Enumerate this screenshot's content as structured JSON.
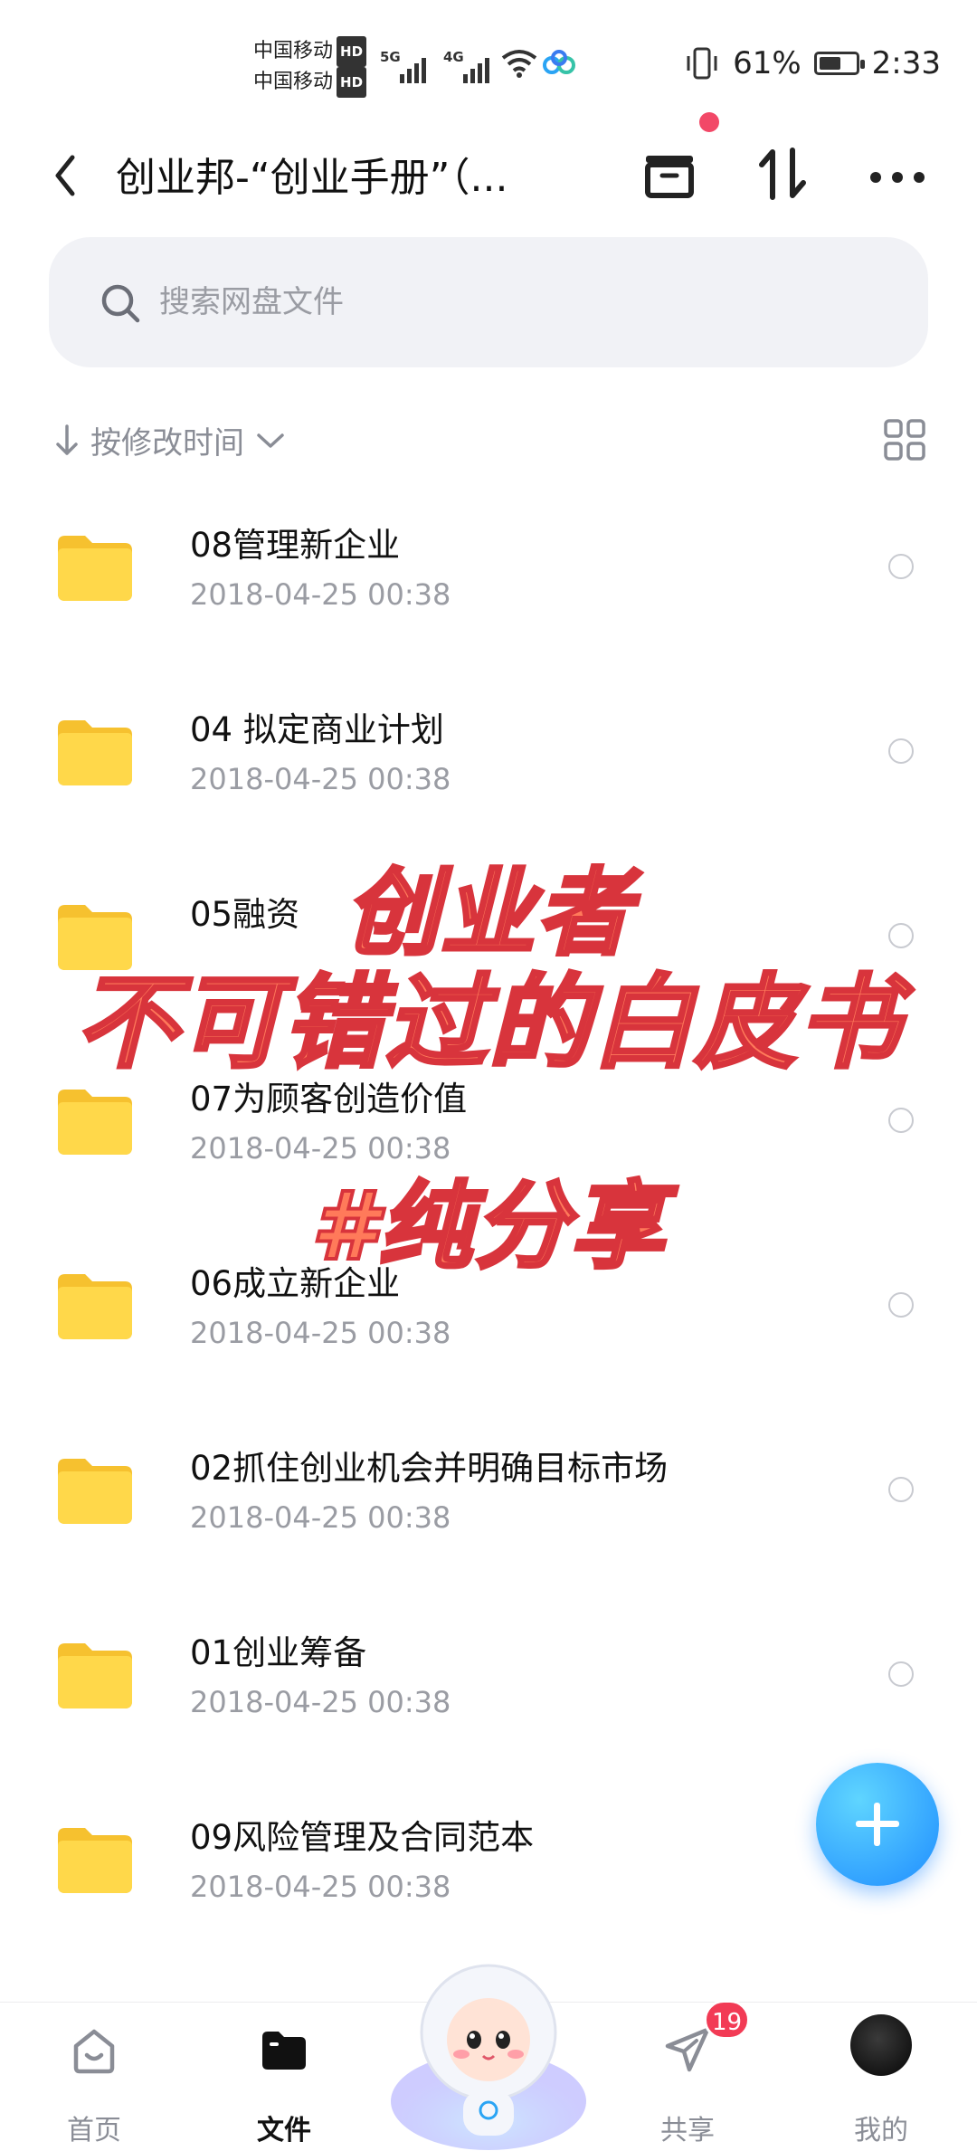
{
  "status_bar": {
    "carrier1": "中国移动",
    "carrier2": "中国移动",
    "hd": "HD",
    "net1": "5G",
    "net2": "4G",
    "battery_pct": "61%",
    "battery_level": 0.61,
    "time": "2:33"
  },
  "header": {
    "title": "创业邦-“创业手册”（...",
    "back_icon": "chevron-left-icon",
    "icons": [
      "archive-icon",
      "transfer-icon",
      "more-icon"
    ]
  },
  "search": {
    "placeholder": "搜索网盘文件"
  },
  "sort": {
    "label": "按修改时间"
  },
  "files": [
    {
      "name": "08管理新企业",
      "date": "2018-04-25  00:38"
    },
    {
      "name": "04 拟定商业计划",
      "date": "2018-04-25  00:38"
    },
    {
      "name": "05融资",
      "date": ""
    },
    {
      "name": "07为顾客创造价值",
      "date": "2018-04-25  00:38"
    },
    {
      "name": "06成立新企业",
      "date": "2018-04-25  00:38"
    },
    {
      "name": "02抓住创业机会并明确目标市场",
      "date": "2018-04-25  00:38"
    },
    {
      "name": "01创业筹备",
      "date": "2018-04-25  00:38"
    },
    {
      "name": "09风险管理及合同范本",
      "date": "2018-04-25  00:38"
    }
  ],
  "overlay": {
    "line1": "创业者",
    "line2": "不可错过的白皮书",
    "line3": "#纯分享"
  },
  "nav": {
    "home": "首页",
    "files": "文件",
    "share": "共享",
    "me": "我的",
    "share_badge": "19"
  },
  "colors": {
    "accent": "#1f8dff",
    "badge": "#f23b55",
    "overlay_fill": "#ff7a5a",
    "overlay_stroke": "#d8343c"
  }
}
